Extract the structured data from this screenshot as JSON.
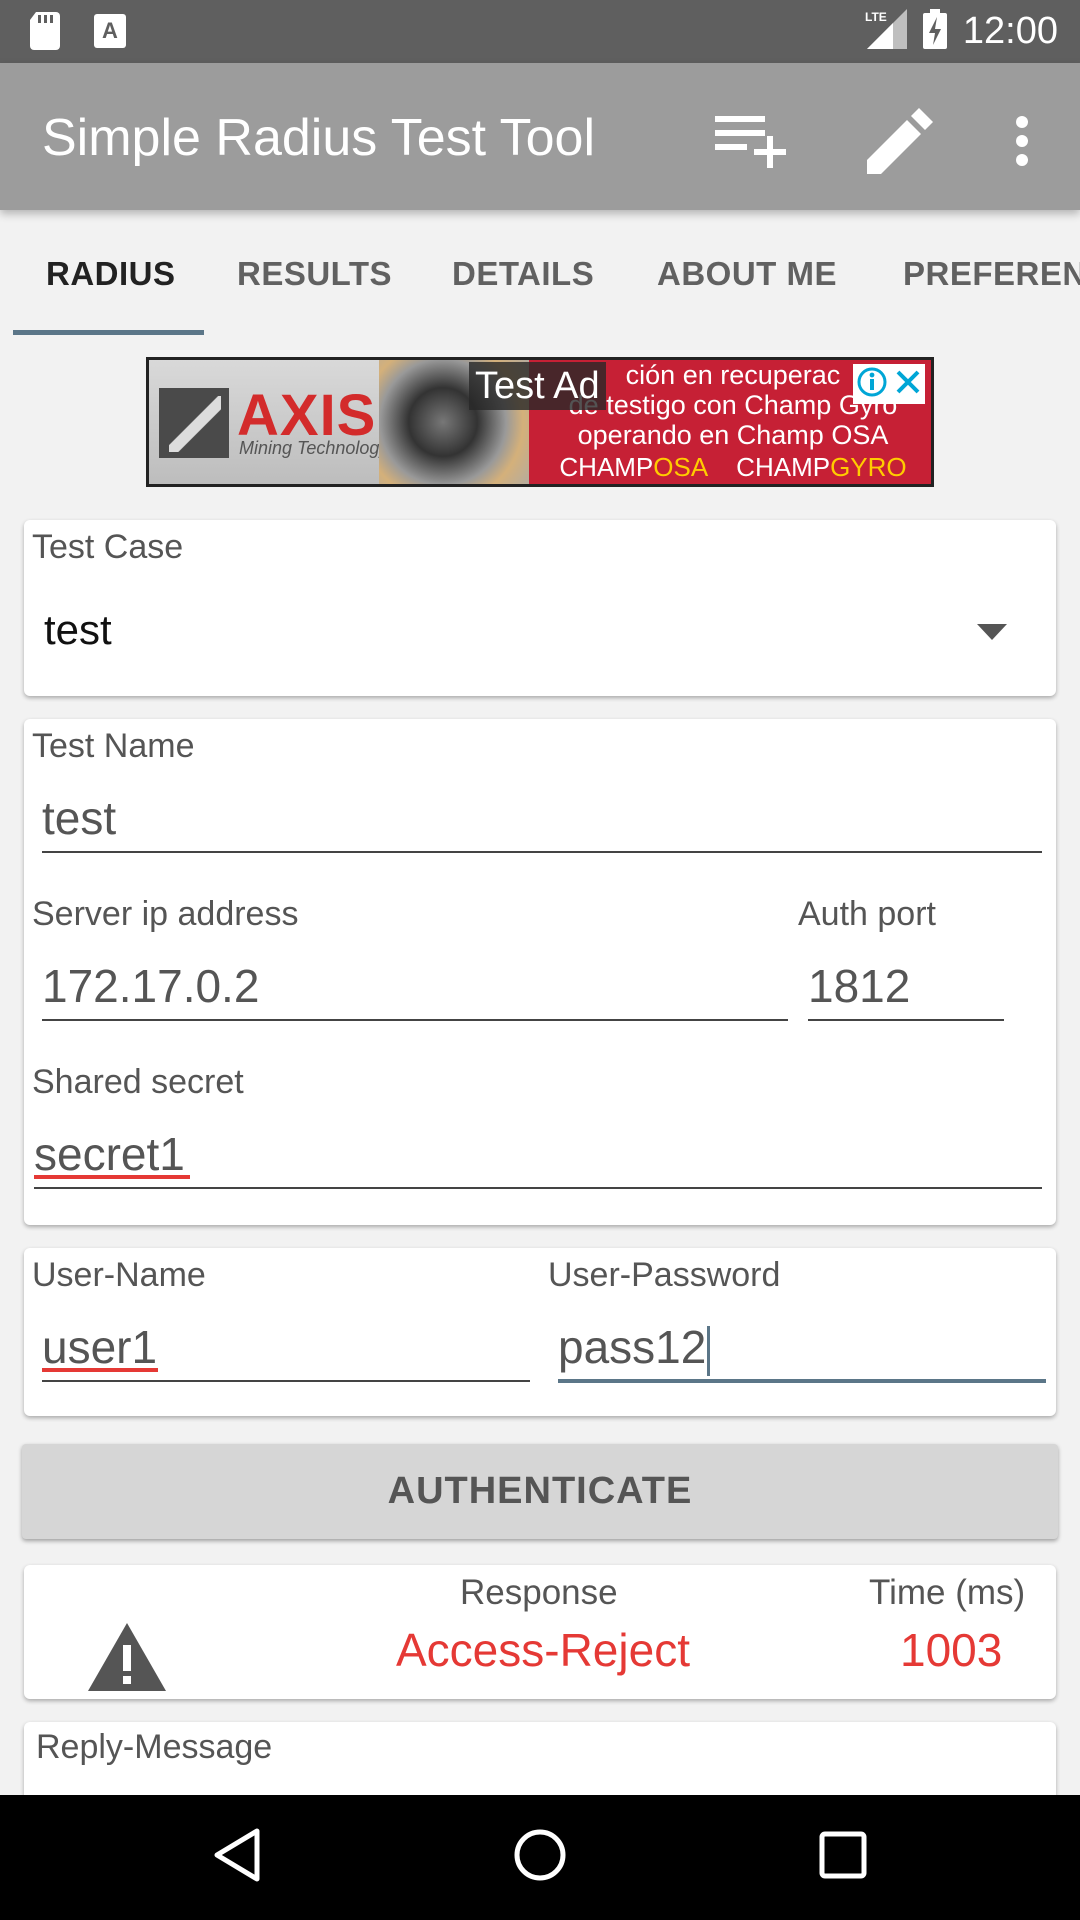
{
  "status_bar": {
    "time": "12:00",
    "network_label": "LTE",
    "icons": [
      "sd-card-icon",
      "text-notification-icon",
      "signal-icon",
      "battery-charging-icon"
    ]
  },
  "app_bar": {
    "title": "Simple Radius Test Tool",
    "actions": [
      "add-to-list-icon",
      "edit-pencil-icon",
      "more-vert-icon"
    ]
  },
  "tabs": [
    {
      "label": "RADIUS",
      "active": true
    },
    {
      "label": "RESULTS",
      "active": false
    },
    {
      "label": "DETAILS",
      "active": false
    },
    {
      "label": "ABOUT ME",
      "active": false
    },
    {
      "label": "PREFEREN",
      "active": false
    }
  ],
  "ad": {
    "badge": "Test Ad",
    "brand": "AXIS",
    "brand_sub": "Mining Technology",
    "line1": "ción en recuperac",
    "line2": "de testigo con Champ Gyro",
    "line3": "operando en Champ OSA",
    "brand_a1": "CHAMP",
    "brand_a2": "OSA",
    "brand_b1": "CHAMP",
    "brand_b2": "GYRO"
  },
  "test_case": {
    "label": "Test Case",
    "selected": "test"
  },
  "connection": {
    "test_name_label": "Test Name",
    "test_name_value": "test",
    "server_ip_label": "Server ip address",
    "server_ip_value": "172.17.0.2",
    "auth_port_label": "Auth port",
    "auth_port_value": "1812",
    "shared_secret_label": "Shared secret",
    "shared_secret_value": "secret1"
  },
  "credentials": {
    "username_label": "User-Name",
    "username_value": "user1",
    "password_label": "User-Password",
    "password_value": "pass12"
  },
  "authenticate_label": "AUTHENTICATE",
  "result": {
    "response_label": "Response",
    "response_value": "Access-Reject",
    "time_label": "Time (ms)",
    "time_value": "1003",
    "accent_color": "#e53935"
  },
  "reply": {
    "label": "Reply-Message"
  }
}
